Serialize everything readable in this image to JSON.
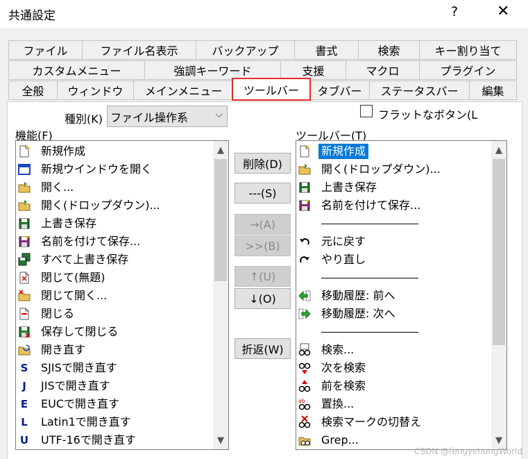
{
  "window": {
    "title": "共通設定",
    "help_label": "?",
    "close_label": "✕"
  },
  "tabs": {
    "row1": [
      "ファイル",
      "ファイル名表示",
      "バックアップ",
      "書式",
      "検索",
      "キー割り当て"
    ],
    "row2": [
      "カスタムメニュー",
      "強調キーワード",
      "支援",
      "マクロ",
      "プラグイン"
    ],
    "row3": [
      "全般",
      "ウィンドウ",
      "メインメニュー",
      "ツールバー",
      "タブバー",
      "ステータスバー",
      "編集"
    ],
    "active": "ツールバー"
  },
  "category": {
    "label": "種別(K)",
    "value": "ファイル操作系"
  },
  "flat_button": {
    "label": "フラットなボタン(L",
    "checked": false
  },
  "functions": {
    "label": "機能(F)",
    "items": [
      {
        "icon": "new-document-icon",
        "label": "新規作成"
      },
      {
        "icon": "new-window-icon",
        "label": "新規ウインドウを開く"
      },
      {
        "icon": "open-folder-icon",
        "label": "開く..."
      },
      {
        "icon": "open-dropdown-icon",
        "label": "開く(ドロップダウン)..."
      },
      {
        "icon": "save-icon",
        "label": "上書き保存"
      },
      {
        "icon": "save-as-icon",
        "label": "名前を付けて保存..."
      },
      {
        "icon": "save-all-icon",
        "label": "すべて上書き保存"
      },
      {
        "icon": "close-untitled-icon",
        "label": "閉じて(無題)"
      },
      {
        "icon": "close-open-icon",
        "label": "閉じて開く..."
      },
      {
        "icon": "close-icon",
        "label": "閉じる"
      },
      {
        "icon": "save-close-icon",
        "label": "保存して閉じる"
      },
      {
        "icon": "reopen-icon",
        "label": "開き直す"
      },
      {
        "icon": "sjis-icon",
        "glyph": "S",
        "label": "SJISで開き直す"
      },
      {
        "icon": "jis-icon",
        "glyph": "J",
        "label": "JISで開き直す"
      },
      {
        "icon": "euc-icon",
        "glyph": "E",
        "label": "EUCで開き直す"
      },
      {
        "icon": "latin1-icon",
        "glyph": "L",
        "label": "Latin1で開き直す"
      },
      {
        "icon": "utf16-icon",
        "glyph": "U",
        "label": "UTF-16で開き直す"
      }
    ]
  },
  "buttons": {
    "delete": "削除(D)",
    "separator": "---(S)",
    "add": "→(A)",
    "insert": ">>(B)",
    "up": "↑(U)",
    "down": "↓(O)",
    "wrap": "折返(W)"
  },
  "toolbar_list": {
    "label": "ツールバー(T)",
    "items": [
      {
        "type": "item",
        "icon": "new-document-icon",
        "label": "新規作成",
        "selected": true
      },
      {
        "type": "item",
        "icon": "open-dropdown-icon",
        "label": "開く(ドロップダウン)..."
      },
      {
        "type": "item",
        "icon": "save-icon",
        "label": "上書き保存"
      },
      {
        "type": "item",
        "icon": "save-as-icon",
        "label": "名前を付けて保存..."
      },
      {
        "type": "separator"
      },
      {
        "type": "item",
        "icon": "undo-icon",
        "label": "元に戻す"
      },
      {
        "type": "item",
        "icon": "redo-icon",
        "label": "やり直し"
      },
      {
        "type": "separator"
      },
      {
        "type": "item",
        "icon": "history-back-icon",
        "label": "移動履歴: 前へ"
      },
      {
        "type": "item",
        "icon": "history-forward-icon",
        "label": "移動履歴: 次へ"
      },
      {
        "type": "separator"
      },
      {
        "type": "item",
        "icon": "search-icon",
        "label": "検索..."
      },
      {
        "type": "item",
        "icon": "find-next-icon",
        "label": "次を検索"
      },
      {
        "type": "item",
        "icon": "find-prev-icon",
        "label": "前を検索"
      },
      {
        "type": "item",
        "icon": "replace-icon",
        "label": "置換..."
      },
      {
        "type": "item",
        "icon": "search-mark-icon",
        "label": "検索マークの切替え"
      },
      {
        "type": "item",
        "icon": "grep-icon",
        "label": "Grep..."
      }
    ]
  },
  "watermark": "CSDN @fengyehongWorld"
}
